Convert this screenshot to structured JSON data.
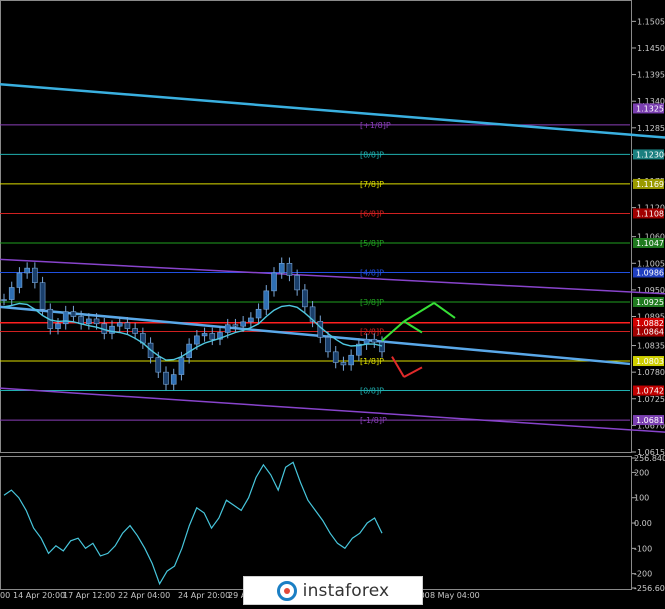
{
  "chart_data": [
    {
      "type": "line",
      "panel": "price",
      "ylim": [
        1.0615,
        1.1545
      ],
      "price_ticks": [
        "1.1505",
        "1.1450",
        "1.1395",
        "1.1340",
        "1.1285",
        "1.1230",
        "1.1175",
        "1.1120",
        "1.1060",
        "1.1005",
        "1.0950",
        "1.0895",
        "1.0835",
        "1.0780",
        "1.0725",
        "1.0670",
        "1.0615"
      ],
      "current_price": "1.0803",
      "price_tags": [
        {
          "label": "1.1325",
          "value": 1.1325,
          "color": "#7a3fb0"
        },
        {
          "label": "1.1230",
          "value": 1.123,
          "color": "#1a7f7f"
        },
        {
          "label": "1.1169",
          "value": 1.1169,
          "color": "#9a9a00"
        },
        {
          "label": "1.1108",
          "value": 1.1108,
          "color": "#a00000"
        },
        {
          "label": "1.1047",
          "value": 1.1047,
          "color": "#1f7a1f"
        },
        {
          "label": "1.0986",
          "value": 1.0986,
          "color": "#1f3fc0"
        },
        {
          "label": "1.0925",
          "value": 1.0925,
          "color": "#1f7a1f"
        },
        {
          "label": "1.0882",
          "value": 1.0882,
          "color": "#d00000"
        },
        {
          "label": "1.0864",
          "value": 1.0864,
          "color": "#a00000"
        },
        {
          "label": "1.0803",
          "value": 1.0803,
          "color": "#cfcf00"
        },
        {
          "label": "1.0742",
          "value": 1.0742,
          "color": "#c00000"
        },
        {
          "label": "1.0681",
          "value": 1.0681,
          "color": "#7a3fb0"
        }
      ],
      "murrey_levels": [
        {
          "label": "[+1/8]P",
          "value": 1.1291,
          "color": "#8a3fb8"
        },
        {
          "label": "[8/8]P",
          "value": 1.123,
          "color": "#20b0b0"
        },
        {
          "label": "[7/8]P",
          "value": 1.1169,
          "color": "#dede00"
        },
        {
          "label": "[6/8]P",
          "value": 1.1108,
          "color": "#d02020"
        },
        {
          "label": "[5/8]P",
          "value": 1.1047,
          "color": "#20a020"
        },
        {
          "label": "[4/8]P",
          "value": 1.0986,
          "color": "#2050e0"
        },
        {
          "label": "[3/8]P",
          "value": 1.0925,
          "color": "#20a020"
        },
        {
          "label": "[2/8]P",
          "value": 1.0864,
          "color": "#d02020"
        },
        {
          "label": "[1/8]P",
          "value": 1.0803,
          "color": "#dede00"
        },
        {
          "label": "[0/8]P",
          "value": 1.0742,
          "color": "#20b0b0"
        },
        {
          "label": "[-1/8]P",
          "value": 1.0681,
          "color": "#8a3fb8"
        }
      ],
      "extra_lines": [
        {
          "value": 1.0882,
          "color": "#ff2020"
        }
      ],
      "trend_lines": [
        {
          "name": "upper-cyan-channel",
          "start": [
            0,
            1.1375
          ],
          "end": [
            665,
            1.1265
          ],
          "color": "#3ab0e0"
        },
        {
          "name": "upper-purple-channel",
          "start": [
            0,
            1.1013
          ],
          "end": [
            665,
            1.0942
          ],
          "color": "#8844cc"
        },
        {
          "name": "lower-purple-channel",
          "start": [
            0,
            1.0747
          ],
          "end": [
            665,
            1.0656
          ],
          "color": "#8844cc"
        },
        {
          "name": "mid-blue-trend",
          "start": [
            0,
            1.0915
          ],
          "end": [
            630,
            1.0797
          ],
          "color": "#5aa8e8"
        }
      ],
      "price_path": [
        1.093,
        1.0955,
        1.0985,
        1.0995,
        1.0965,
        1.091,
        1.087,
        1.088,
        1.0905,
        1.0895,
        1.088,
        1.089,
        1.088,
        1.086,
        1.0875,
        1.0882,
        1.087,
        1.086,
        1.084,
        1.081,
        1.078,
        1.0755,
        1.0775,
        1.081,
        1.0838,
        1.0855,
        1.086,
        1.0848,
        1.0862,
        1.0878,
        1.0875,
        1.0884,
        1.0892,
        1.091,
        1.0948,
        1.0985,
        1.1005,
        1.098,
        1.095,
        1.0915,
        1.0885,
        1.0852,
        1.0822,
        1.08,
        1.0795,
        1.0815,
        1.0838,
        1.0848,
        1.0842,
        1.0822
      ],
      "ma_path": [
        1.0915,
        1.0918,
        1.0922,
        1.092,
        1.091,
        1.0897,
        1.0888,
        1.0885,
        1.0886,
        1.0884,
        1.088,
        1.0876,
        1.0873,
        1.0868,
        1.0864,
        1.0862,
        1.0858,
        1.085,
        1.084,
        1.0826,
        1.0814,
        1.0805,
        1.0806,
        1.0812,
        1.0822,
        1.0832,
        1.084,
        1.0845,
        1.085,
        1.0856,
        1.0862,
        1.0866,
        1.0872,
        1.088,
        1.0895,
        1.0908,
        1.0916,
        1.0918,
        1.0914,
        1.0902,
        1.0888,
        1.0873,
        1.086,
        1.0848,
        1.0838,
        1.0834,
        1.0835,
        1.0838,
        1.0838,
        1.0834
      ],
      "forecast_up": [
        [
          1.0845,
          1.0885
        ],
        [
          1.0885,
          1.0862
        ],
        [
          1.0885,
          1.0923
        ],
        [
          1.0923,
          1.0892
        ]
      ],
      "forecast_down": [
        [
          1.0812,
          1.077
        ],
        [
          1.077,
          1.079
        ]
      ]
    },
    {
      "type": "line",
      "panel": "oscillator",
      "ylim": [
        -256.604,
        256.8402
      ],
      "osc_ticks": [
        "256.8402",
        "200",
        "100",
        "0.00",
        "-100",
        "-200",
        "-256.604"
      ],
      "values": [
        110,
        130,
        100,
        50,
        -20,
        -60,
        -120,
        -90,
        -110,
        -70,
        -60,
        -100,
        -80,
        -130,
        -120,
        -90,
        -40,
        -10,
        -50,
        -100,
        -160,
        -240,
        -190,
        -170,
        -100,
        -10,
        60,
        40,
        -20,
        20,
        90,
        70,
        50,
        100,
        180,
        230,
        190,
        130,
        220,
        240,
        160,
        90,
        50,
        10,
        -40,
        -80,
        -100,
        -60,
        -40,
        0,
        20,
        -40
      ]
    }
  ],
  "time_labels": [
    "00",
    "14 Apr 20:00",
    "17 Apr 12:00",
    "22 Apr 04:00",
    "24 Apr 20:00",
    "29 Apr",
    "5 May 12:00",
    "8 May 04:00"
  ],
  "watermark_text": "instaforex",
  "colors": {
    "background": "#000000",
    "axis_text": "#c8c8c8",
    "grid": "#606060",
    "candle": "#7aa7d8",
    "oscillator": "#47c6dc",
    "ma": "#4fc8e0"
  }
}
